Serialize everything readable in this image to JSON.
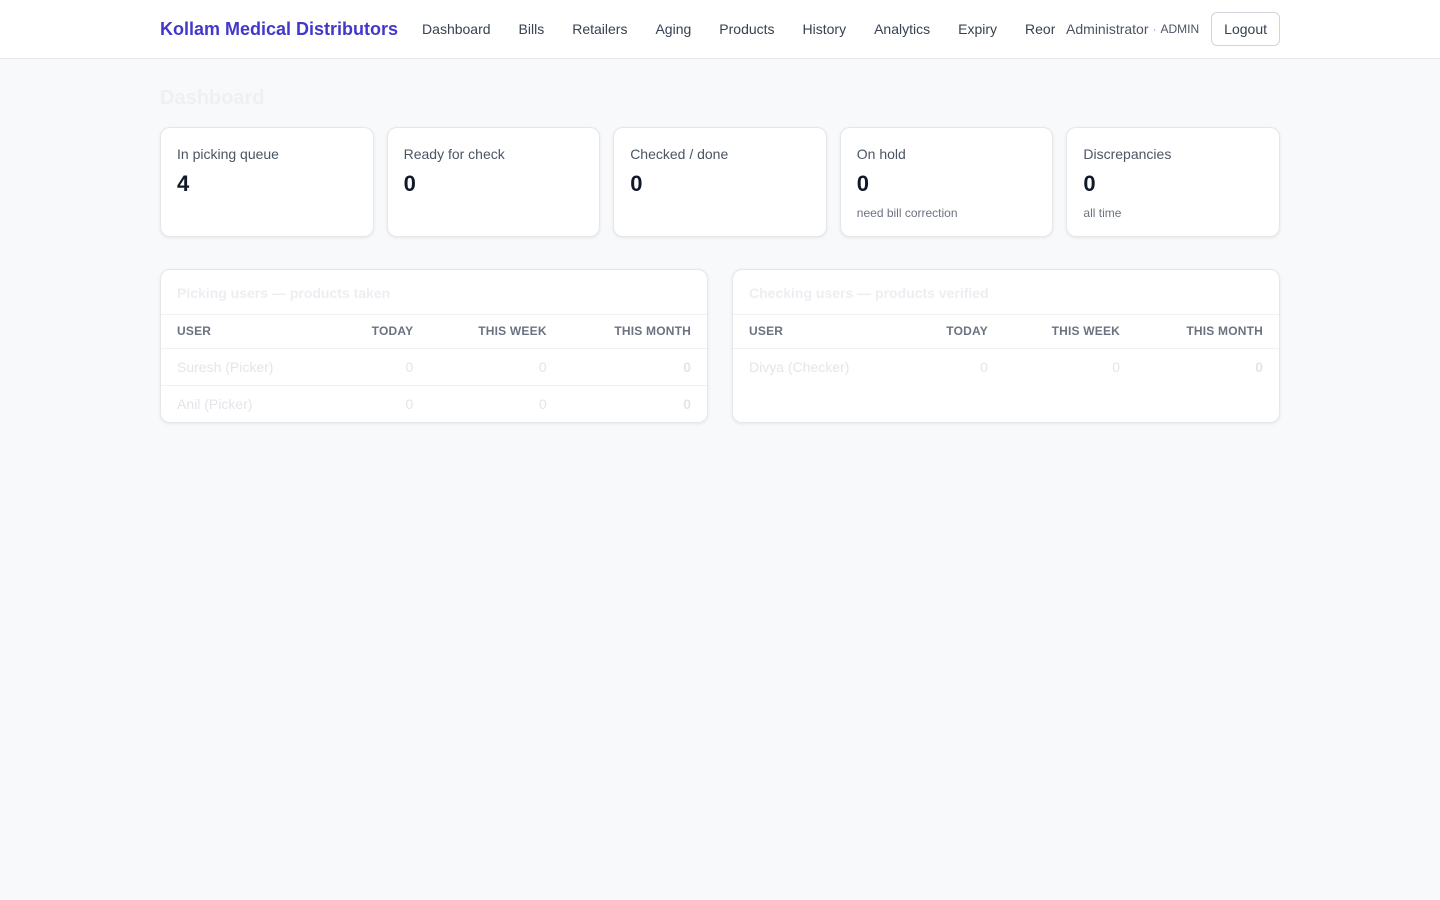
{
  "header": {
    "brand": "Kollam Medical Distributors",
    "nav": [
      "Dashboard",
      "Bills",
      "Retailers",
      "Aging",
      "Products",
      "History",
      "Analytics",
      "Expiry",
      "Reorder"
    ],
    "user_name": "Administrator",
    "separator": "·",
    "user_role": "ADMIN",
    "logout_label": "Logout"
  },
  "page": {
    "title": "Dashboard"
  },
  "stats": [
    {
      "label": "In picking queue",
      "value": "4",
      "note": ""
    },
    {
      "label": "Ready for check",
      "value": "0",
      "note": ""
    },
    {
      "label": "Checked / done",
      "value": "0",
      "note": ""
    },
    {
      "label": "On hold",
      "value": "0",
      "note": "need bill correction"
    },
    {
      "label": "Discrepancies",
      "value": "0",
      "note": "all time"
    }
  ],
  "picking": {
    "title": "Picking users — products taken",
    "columns": [
      "User",
      "Today",
      "This week",
      "This month"
    ],
    "rows": [
      {
        "user": "Suresh (Picker)",
        "today": "0",
        "week": "0",
        "month": "0"
      },
      {
        "user": "Anil (Picker)",
        "today": "0",
        "week": "0",
        "month": "0"
      }
    ]
  },
  "checking": {
    "title": "Checking users — products verified",
    "columns": [
      "User",
      "Today",
      "This week",
      "This month"
    ],
    "rows": [
      {
        "user": "Divya (Checker)",
        "today": "0",
        "week": "0",
        "month": "0"
      }
    ]
  },
  "colors": {
    "brand": "#4338ca",
    "background": "#f8f9fb"
  }
}
